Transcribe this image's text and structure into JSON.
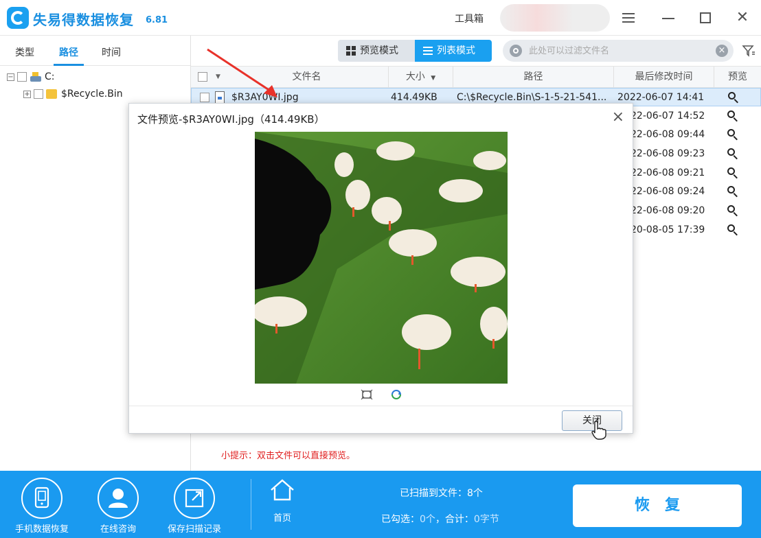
{
  "app": {
    "title": "失易得数据恢复",
    "version": "6.81",
    "toolbox_label": "工具箱"
  },
  "left_panel": {
    "tabs": [
      {
        "label": "类型",
        "active": false
      },
      {
        "label": "路径",
        "active": true
      },
      {
        "label": "时间",
        "active": false
      }
    ],
    "tree": [
      {
        "label": "C:",
        "level": 0
      },
      {
        "label": "$Recycle.Bin",
        "level": 1
      }
    ]
  },
  "toolbar": {
    "thumb_mode_label": "预览模式",
    "list_mode_label": "列表模式",
    "search_placeholder": "此处可以过滤文件名"
  },
  "table": {
    "columns": [
      "文件名",
      "大小",
      "路径",
      "最后修改时间",
      "预览"
    ],
    "rows": [
      {
        "name": "$R3AY0WI.jpg",
        "size": "414.49KB",
        "path": "C:\\$Recycle.Bin\\S-1-5-21-541...",
        "modified": "2022-06-07  14:41",
        "selected": true
      },
      {
        "name": "",
        "size": "",
        "path": "",
        "modified": "22-06-07  14:52",
        "selected": false
      },
      {
        "name": "",
        "size": "",
        "path": "",
        "modified": "22-06-08  09:44",
        "selected": false
      },
      {
        "name": "",
        "size": "",
        "path": "",
        "modified": "22-06-08  09:23",
        "selected": false
      },
      {
        "name": "",
        "size": "",
        "path": "",
        "modified": "22-06-08  09:21",
        "selected": false
      },
      {
        "name": "",
        "size": "",
        "path": "",
        "modified": "22-06-08  09:24",
        "selected": false
      },
      {
        "name": "",
        "size": "",
        "path": "",
        "modified": "22-06-08  09:20",
        "selected": false
      },
      {
        "name": "",
        "size": "",
        "path": "",
        "modified": "20-08-05  17:39",
        "selected": false
      }
    ]
  },
  "hint": "小提示：双击文件可以直接预览。",
  "preview_dialog": {
    "title": "文件预览-$R3AY0WI.jpg（414.49KB）",
    "close_label": "关闭"
  },
  "bottom_bar": {
    "items": [
      {
        "label": "手机数据恢复",
        "icon": "phone-icon"
      },
      {
        "label": "在线咨询",
        "icon": "support-person-icon"
      },
      {
        "label": "保存扫描记录",
        "icon": "export-icon"
      }
    ],
    "home_label": "首页",
    "scanned_text": "已扫描到文件：8个",
    "selected_label": "已勾选：",
    "selected_count": "0个",
    "total_label": "，合计：",
    "total_size": "0字节",
    "recover_label": "恢复"
  },
  "colors": {
    "accent": "#1a9af0",
    "hint": "#e02020",
    "selected_row": "#dcecfb"
  }
}
